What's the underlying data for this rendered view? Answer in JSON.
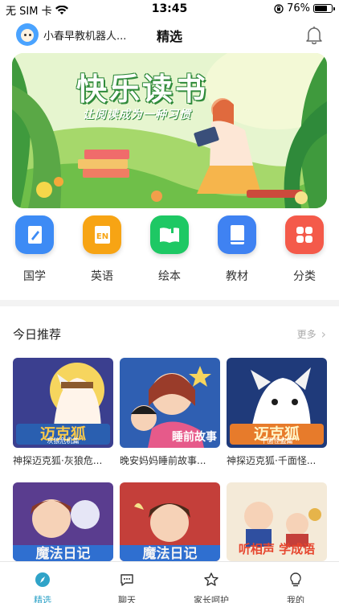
{
  "status_bar": {
    "carrier": "无 SIM 卡",
    "time": "13:45",
    "battery": "76%",
    "battery_level": 0.76
  },
  "header": {
    "account_name": "小春早教机器人...",
    "title": "精选"
  },
  "banner": {
    "title": "快乐读书",
    "subtitle": "让阅读成为一种习惯"
  },
  "categories": [
    {
      "label": "国学",
      "icon": "pen-book-icon",
      "color": "#3d8bf5"
    },
    {
      "label": "英语",
      "icon": "en-book-icon",
      "color": "#f7a414"
    },
    {
      "label": "绘本",
      "icon": "open-book-icon",
      "color": "#1ec864"
    },
    {
      "label": "教材",
      "icon": "textbook-icon",
      "color": "#3f82f2"
    },
    {
      "label": "分类",
      "icon": "grid-icon",
      "color": "#f45a4a"
    }
  ],
  "recommend": {
    "title": "今日推荐",
    "more": "更多",
    "items": [
      {
        "title": "神探迈克狐·灰狼危...",
        "cover_text": "迈克狐",
        "cover_sub": "灰狼危机篇"
      },
      {
        "title": "晚安妈妈睡前故事...",
        "cover_text": "睡前故事"
      },
      {
        "title": "神探迈克狐·千面怪...",
        "cover_text": "迈克狐",
        "cover_sub": "千面怪盗篇"
      },
      {
        "title": "",
        "cover_text": "魔法日记"
      },
      {
        "title": "",
        "cover_text": "魔法日记"
      },
      {
        "title": "",
        "cover_text": "听相声 学成语"
      }
    ]
  },
  "tabs": [
    {
      "label": "精选",
      "icon": "compass-icon",
      "active": true
    },
    {
      "label": "聊天",
      "icon": "chat-icon",
      "active": false
    },
    {
      "label": "家长呵护",
      "icon": "star-icon",
      "active": false
    },
    {
      "label": "我的",
      "icon": "bulb-icon",
      "active": false
    }
  ],
  "colors": {
    "accent": "#2fa3c8",
    "banner_bg": "#dff2c8"
  }
}
